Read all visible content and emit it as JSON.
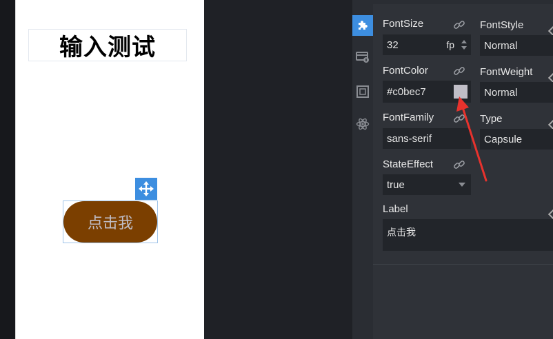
{
  "canvas": {
    "title_text": "输入测试",
    "button_label": "点击我",
    "button_bg_color": "#7b3f00",
    "button_text_color": "#c0bec7"
  },
  "sidebar": {
    "icons": [
      "puzzle-icon",
      "card-info-icon",
      "frame-icon",
      "atom-icon"
    ],
    "active": "puzzle-icon"
  },
  "props": {
    "font_size": {
      "label": "FontSize",
      "value": "32",
      "unit": "fp"
    },
    "font_style": {
      "label": "FontStyle",
      "value": "Normal"
    },
    "font_color": {
      "label": "FontColor",
      "value": "#c0bec7"
    },
    "font_weight": {
      "label": "FontWeight",
      "value": "Normal"
    },
    "font_family": {
      "label": "FontFamily",
      "value": "sans-serif"
    },
    "type": {
      "label": "Type",
      "value": "Capsule"
    },
    "state_effect": {
      "label": "StateEffect",
      "value": "true"
    },
    "label": {
      "label": "Label",
      "value": "点击我"
    }
  },
  "colors": {
    "accent": "#3d8ee0",
    "panel_bg": "#2f3238",
    "field_bg": "#22252a",
    "annotation_arrow": "#e8322d"
  }
}
